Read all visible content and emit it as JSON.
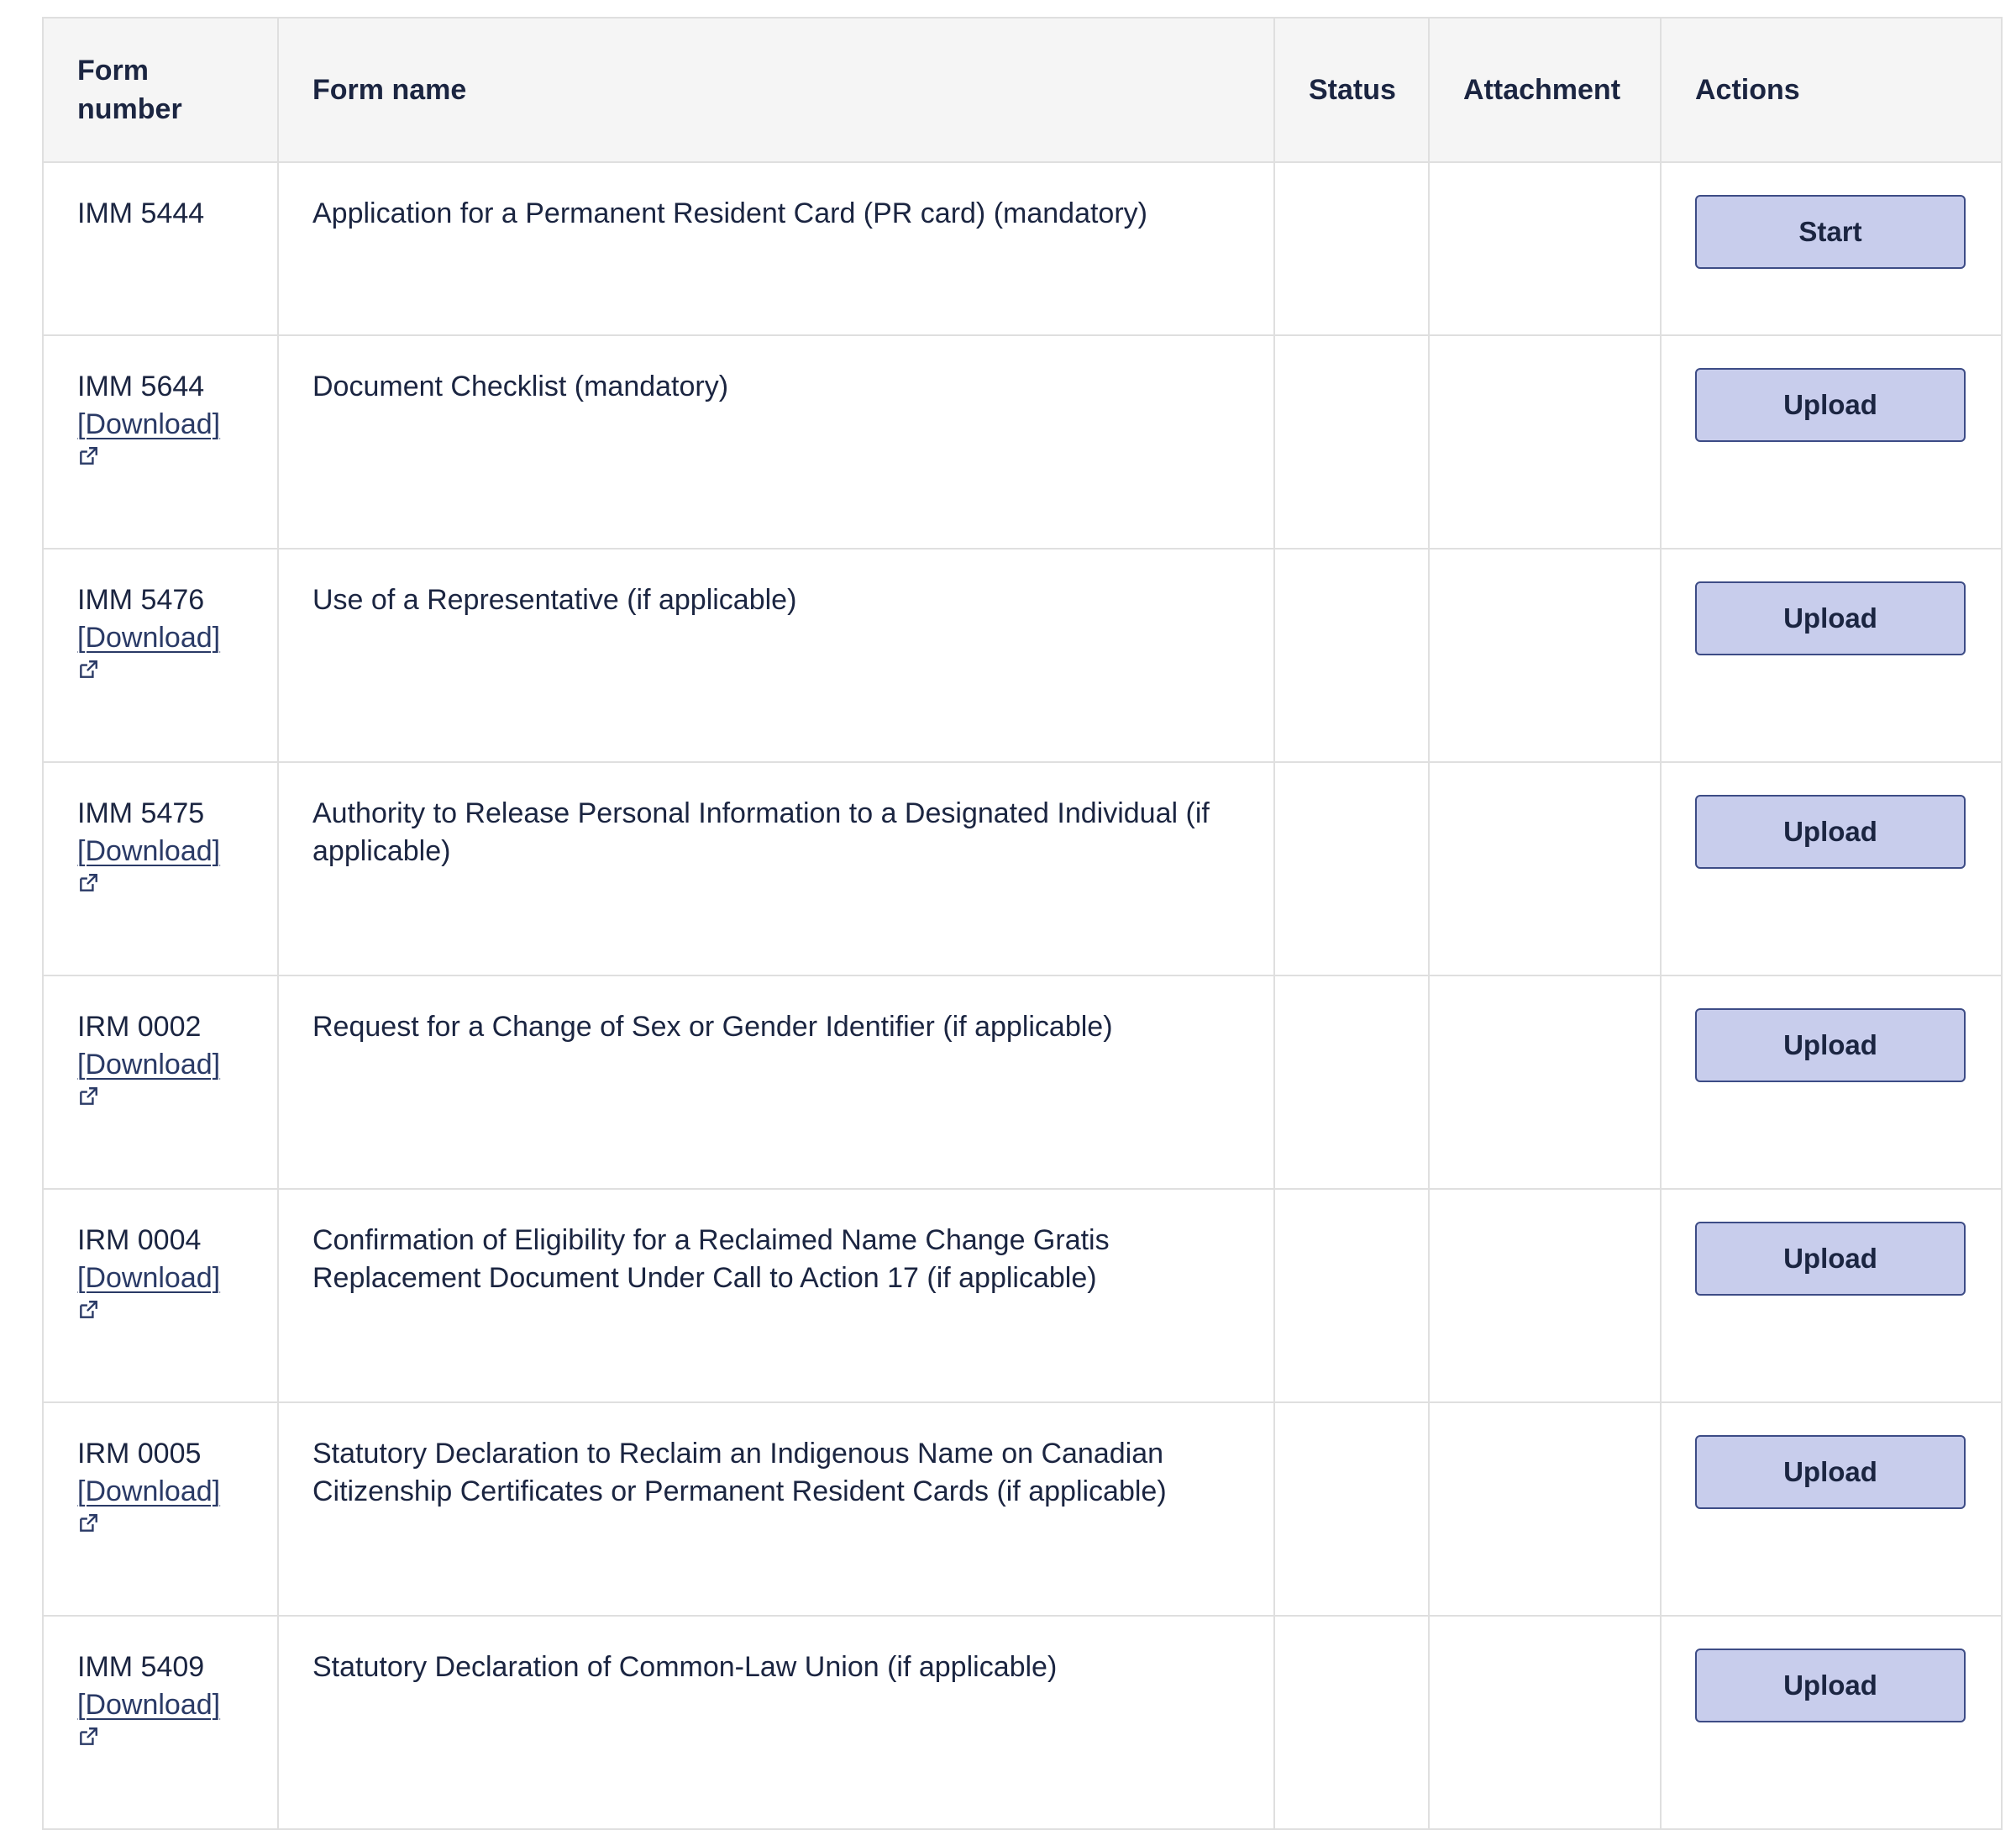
{
  "table": {
    "headers": {
      "form_number_line1": "Form",
      "form_number_line2": "number",
      "form_name": "Form name",
      "status": "Status",
      "attachment": "Attachment",
      "actions": "Actions"
    },
    "rows": [
      {
        "form_number": "IMM 5444",
        "download_label": "",
        "form_name": "Application for a Permanent Resident Card (PR card) (mandatory)",
        "status": "",
        "attachment": "",
        "action_label": "Start"
      },
      {
        "form_number": "IMM 5644",
        "download_label": "[Download]",
        "form_name": "Document Checklist (mandatory)",
        "status": "",
        "attachment": "",
        "action_label": "Upload"
      },
      {
        "form_number": "IMM 5476",
        "download_label": "[Download]",
        "form_name": "Use of a Representative (if applicable)",
        "status": "",
        "attachment": "",
        "action_label": "Upload"
      },
      {
        "form_number": "IMM 5475",
        "download_label": "[Download]",
        "form_name": "Authority to Release Personal Information to a Designated Individual (if applicable)",
        "status": "",
        "attachment": "",
        "action_label": "Upload"
      },
      {
        "form_number": "IRM 0002",
        "download_label": "[Download]",
        "form_name": "Request for a Change of Sex or Gender Identifier (if applicable)",
        "status": "",
        "attachment": "",
        "action_label": "Upload"
      },
      {
        "form_number": "IRM 0004",
        "download_label": "[Download]",
        "form_name": "Confirmation of Eligibility for a Reclaimed Name Change Gratis Replacement Document Under Call to Action 17 (if applicable)",
        "status": "",
        "attachment": "",
        "action_label": "Upload"
      },
      {
        "form_number": "IRM 0005",
        "download_label": "[Download]",
        "form_name": "Statutory Declaration to Reclaim an Indigenous Name on Canadian Citizenship Certificates or Permanent Resident Cards (if applicable)",
        "status": "",
        "attachment": "",
        "action_label": "Upload"
      },
      {
        "form_number": "IMM 5409",
        "download_label": "[Download]",
        "form_name": "Statutory Declaration of Common-Law Union (if applicable)",
        "status": "",
        "attachment": "",
        "action_label": "Upload"
      }
    ]
  },
  "icons": {
    "external_link": "external-link-icon"
  },
  "colors": {
    "text": "#1b2541",
    "header_bg": "#f5f5f5",
    "border": "#dfdfdf",
    "button_bg": "#c8cdec",
    "button_border": "#3d4c86",
    "link": "#2a3a66"
  }
}
